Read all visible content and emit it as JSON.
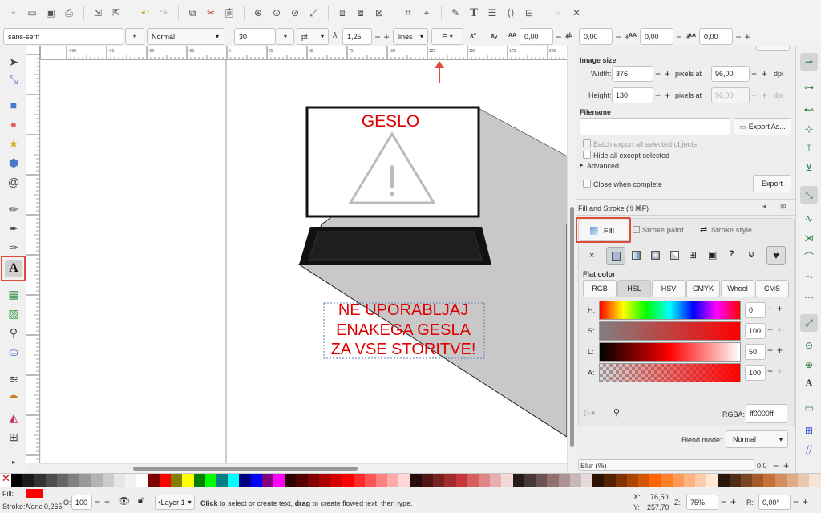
{
  "command_bar": {
    "icons": [
      "new-document-icon",
      "open-icon",
      "save-icon",
      "print-icon",
      "import-icon",
      "export-icon",
      "undo-icon",
      "redo-icon",
      "copy-icon",
      "cut-icon",
      "paste-icon",
      "zoom-selection-icon",
      "zoom-drawing-icon",
      "zoom-page-icon",
      "zoom-width-icon",
      "duplicate-icon",
      "clone-icon",
      "unlink-clone-icon",
      "group-icon",
      "ungroup-icon",
      "fill-stroke-icon",
      "text-font-icon",
      "layers-icon",
      "xml-editor-icon",
      "align-icon",
      "find-icon",
      "preferences-icon"
    ]
  },
  "text_toolbar": {
    "font_family": "sans-serif",
    "font_style": "Normal",
    "font_size": "30",
    "unit": "pt",
    "line_spacing": "1,25",
    "line_spacing_unit": "lines",
    "superscript_label": "x²",
    "subscript_label": "xᵧ",
    "letter_spacing": "0,00",
    "word_spacing": "0,00",
    "horizontal_kerning": "0,00",
    "vertical_shift": "0,00"
  },
  "ruler": {
    "ticks": [
      "-100",
      "-75",
      "-50",
      "-25",
      "0",
      "25",
      "50",
      "75",
      "100",
      "125",
      "150",
      "175",
      "200"
    ]
  },
  "canvas": {
    "monitor_title": "GESLO",
    "monitor_symbol": "!",
    "caption_lines": [
      "NE UPORABLJAJ",
      "ENAKEGA GESLA",
      "ZA VSE STORITVE!"
    ],
    "text_color": "#ff0000"
  },
  "export_panel": {
    "image_size_label": "Image size",
    "width_label": "Width:",
    "width_value": "376",
    "height_label": "Height:",
    "height_value": "130",
    "pixels_at_label": "pixels at",
    "dpi_value_1": "96,00",
    "dpi_value_2": "96,00",
    "dpi_label": "dpi",
    "filename_label": "Filename",
    "filename_value": "",
    "export_as_label": "Export As...",
    "batch_export_label": "Batch export all selected objects",
    "hide_all_label": "Hide all except selected",
    "advanced_label": "Advanced",
    "close_when_complete_label": "Close when complete",
    "export_label": "Export"
  },
  "fill_stroke": {
    "dialog_title": "Fill and Stroke (⇧⌘F)",
    "tabs": [
      "Fill",
      "Stroke paint",
      "Stroke style"
    ],
    "active_tab": "Fill",
    "paint_types": [
      "×",
      "flat",
      "linear",
      "radial",
      "mesh",
      "pattern",
      "swatch",
      "unset",
      "evenodd",
      "nonzero"
    ],
    "flat_color_label": "Flat color",
    "color_modes": [
      "RGB",
      "HSL",
      "HSV",
      "CMYK",
      "Wheel",
      "CMS"
    ],
    "active_mode": "HSL",
    "channels": [
      {
        "label": "H:",
        "value": "0"
      },
      {
        "label": "S:",
        "value": "100"
      },
      {
        "label": "L:",
        "value": "50"
      },
      {
        "label": "A:",
        "value": "100"
      }
    ],
    "rgba_label": "RGBA:",
    "rgba_value": "ff0000ff",
    "blend_mode_label": "Blend mode:",
    "blend_mode_value": "Normal",
    "blur_label": "Blur (%)",
    "blur_value": "0,0"
  },
  "palette_colors": [
    "#000000",
    "#1a1a1a",
    "#333333",
    "#4d4d4d",
    "#666666",
    "#808080",
    "#999999",
    "#b3b3b3",
    "#cccccc",
    "#e6e6e6",
    "#f2f2f2",
    "#ffffff",
    "#800000",
    "#ff0000",
    "#808000",
    "#ffff00",
    "#008000",
    "#00ff00",
    "#008080",
    "#00ffff",
    "#000080",
    "#0000ff",
    "#800080",
    "#ff00ff",
    "#2b0000",
    "#550000",
    "#800000",
    "#aa0000",
    "#d40000",
    "#ff0000",
    "#ff2a2a",
    "#ff5555",
    "#ff8080",
    "#ffaaaa",
    "#ffd5d5",
    "#280b0b",
    "#501616",
    "#782121",
    "#a02c2c",
    "#c83737",
    "#d35f5f",
    "#de8787",
    "#e9afaf",
    "#f4d7d7",
    "#241c1c",
    "#483737",
    "#6c5353",
    "#916f6f",
    "#ac9393",
    "#c8b7b7",
    "#e3dbdb",
    "#2b1100",
    "#552200",
    "#803300",
    "#aa4400",
    "#d45500",
    "#ff6600",
    "#ff7f2a",
    "#ff9955",
    "#ffb380",
    "#ffccaa",
    "#ffe6d5",
    "#28170b",
    "#502d16",
    "#784421",
    "#a05a2c",
    "#c87137",
    "#d38d5f",
    "#deaa87",
    "#e9c6af",
    "#f4e3d7"
  ],
  "statusbar": {
    "fill_label": "Fill:",
    "stroke_label": "Stroke:",
    "stroke_value": "None",
    "stroke_width": "0,265",
    "opacity_label": "O:",
    "opacity_value": "100",
    "layer_label": "•Layer 1",
    "message_bold_1": "Click",
    "message_1": " to select or create text, ",
    "message_bold_2": "drag",
    "message_2": " to create flowed text; then type.",
    "x_label": "X:",
    "x_value": "76,50",
    "y_label": "Y:",
    "y_value": "257,70",
    "zoom_label": "Z:",
    "zoom_value": "75%",
    "rotation_label": "R:",
    "rotation_value": "0,00°"
  },
  "colors": {
    "accent_red": "#e04a3a",
    "fill_red": "#ff0000"
  }
}
